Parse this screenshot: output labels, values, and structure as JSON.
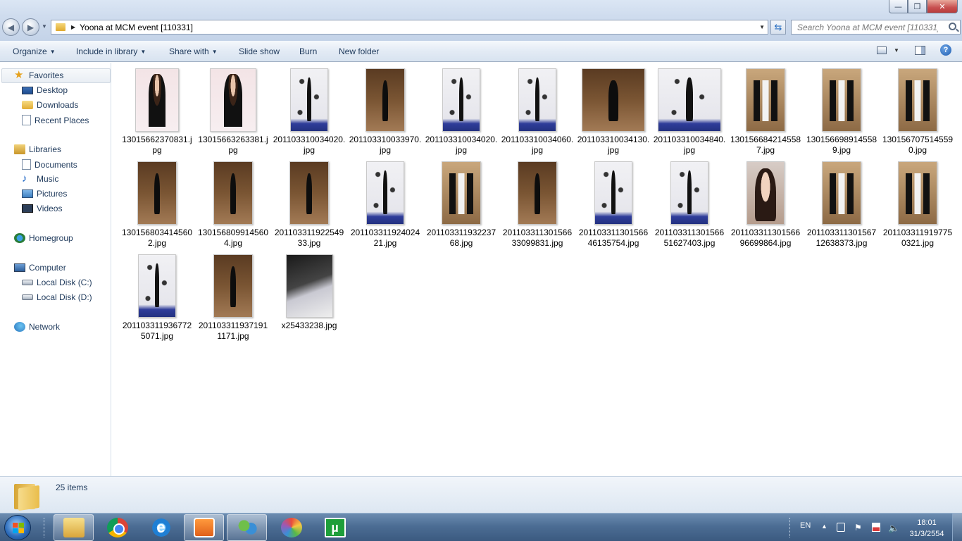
{
  "window": {
    "minimize_glyph": "—",
    "maximize_glyph": "❐",
    "close_glyph": "✕"
  },
  "address": {
    "path": "Yoona at MCM event [110331]",
    "search_placeholder": "Search Yoona at MCM event [110331]"
  },
  "toolbar": {
    "organize": "Organize",
    "include_in_library": "Include in library",
    "share_with": "Share with",
    "slide_show": "Slide show",
    "burn": "Burn",
    "new_folder": "New folder",
    "help": "?"
  },
  "sidebar": {
    "favorites": "Favorites",
    "desktop": "Desktop",
    "downloads": "Downloads",
    "recent_places": "Recent Places",
    "libraries": "Libraries",
    "documents": "Documents",
    "music": "Music",
    "pictures": "Pictures",
    "videos": "Videos",
    "homegroup": "Homegroup",
    "computer": "Computer",
    "local_disk_c": "Local Disk (C:)",
    "local_disk_d": "Local Disk (D:)",
    "network": "Network"
  },
  "files": [
    {
      "name": "13015662370831.jpg",
      "style": "pink"
    },
    {
      "name": "13015663263381.jpg",
      "style": "pink"
    },
    {
      "name": "201103310034020.jpg",
      "style": "mcm"
    },
    {
      "name": "201103310033970.jpg",
      "style": "brown"
    },
    {
      "name": "201103310034020.jpg",
      "style": "mcm"
    },
    {
      "name": "201103310034060.jpg",
      "style": "mcm"
    },
    {
      "name": "201103310034130.jpg",
      "style": "brown"
    },
    {
      "name": "201103310034840.jpg",
      "style": "mcm"
    },
    {
      "name": "1301566842145587.jpg",
      "style": "group"
    },
    {
      "name": "1301566989145589.jpg",
      "style": "group"
    },
    {
      "name": "1301567075145590.jpg",
      "style": "group"
    },
    {
      "name": "1301568034145602.jpg",
      "style": "brown"
    },
    {
      "name": "1301568099145604.jpg",
      "style": "brown"
    },
    {
      "name": "20110331192254933.jpg",
      "style": "brown"
    },
    {
      "name": "20110331192402421.jpg",
      "style": "mcm"
    },
    {
      "name": "20110331193223768.jpg",
      "style": "group"
    },
    {
      "name": "20110331130156633099831.jpg",
      "style": "brown"
    },
    {
      "name": "20110331130156646135754.jpg",
      "style": "mcm"
    },
    {
      "name": "20110331130156651627403.jpg",
      "style": "mcm"
    },
    {
      "name": "20110331130156696699864.jpg",
      "style": "face"
    },
    {
      "name": "20110331130156712638373.jpg",
      "style": "group"
    },
    {
      "name": "2011033119197750321.jpg",
      "style": "group"
    },
    {
      "name": "2011033119367725071.jpg",
      "style": "mcm"
    },
    {
      "name": "2011033119371911171.jpg",
      "style": "brown"
    },
    {
      "name": "x25433238.jpg",
      "style": "dark"
    }
  ],
  "status": {
    "count": "25 items"
  },
  "taskbar": {
    "ie_glyph": "e",
    "utorrent_glyph": "µ"
  },
  "tray": {
    "language": "EN",
    "time": "18:01",
    "date": "31/3/2554"
  }
}
